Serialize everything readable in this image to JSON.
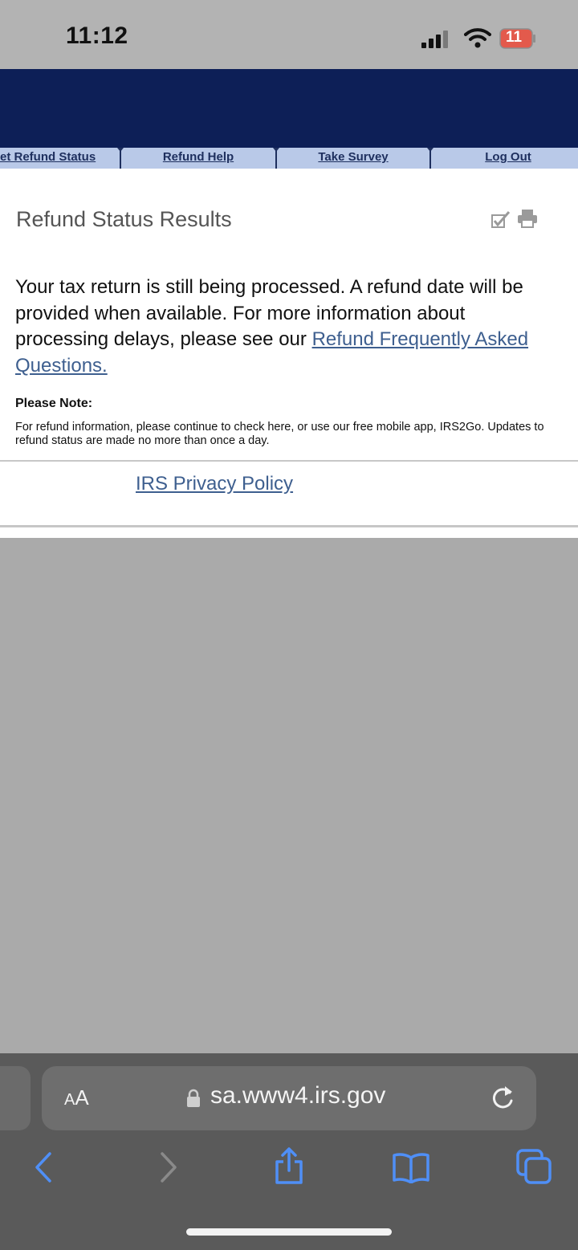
{
  "status_bar": {
    "time": "11:12",
    "battery": "11"
  },
  "nav": {
    "tabs": [
      "et Refund Status",
      "Refund Help",
      "Take Survey",
      "Log Out"
    ]
  },
  "page": {
    "title": "Refund Status Results",
    "message_text": "Your tax return is still being processed. A refund date will be provided when available. For more information about processing delays, please see our ",
    "message_link": "Refund Frequently Asked Questions.",
    "note_title": "Please Note:",
    "note_text": "For refund information, please continue to check here, or use our free mobile app, IRS2Go. Updates to refund status are made no more than once a day.",
    "privacy_link": "IRS Privacy Policy"
  },
  "browser": {
    "text_size_label_large": "A",
    "text_size_label_small": "A",
    "url": "sa.www4.irs.gov"
  },
  "colors": {
    "header_navy": "#0d1f57",
    "nav_background": "#b9c9e8",
    "link_blue": "#3e5f8f",
    "browser_accent": "#4f8ff7"
  }
}
